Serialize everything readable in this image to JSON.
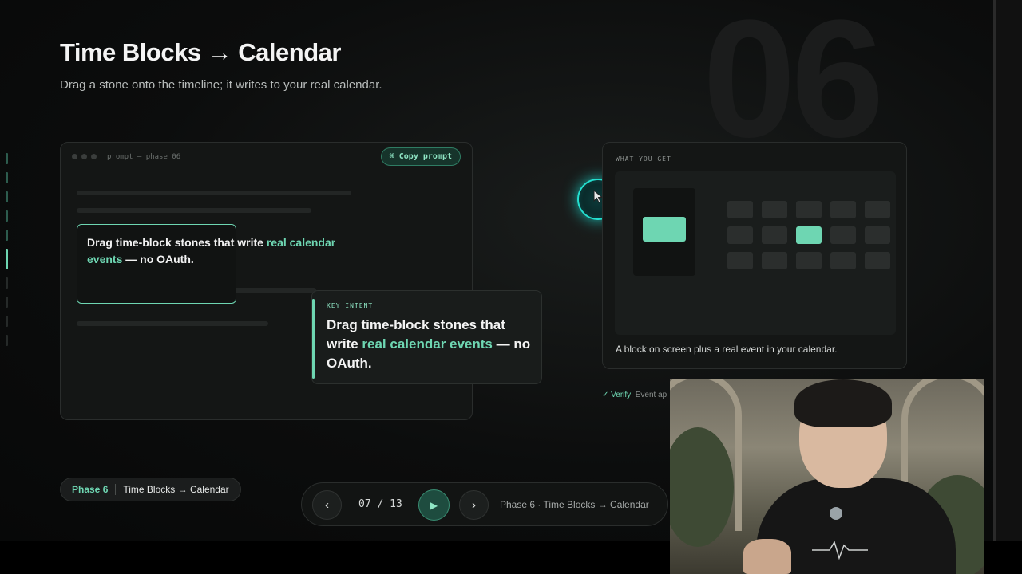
{
  "slide": {
    "title": "Time Blocks → Calendar",
    "subtitle": "Drag a stone onto the timeline; it writes to your real calendar.",
    "background_number": "06"
  },
  "prompt_panel": {
    "label": "prompt — phase 06",
    "copy_button": "⌘ Copy prompt",
    "drag_text_pre": "Drag time-block stones that write ",
    "drag_text_accent": "real calendar events",
    "drag_text_post": " — no OAuth."
  },
  "intent": {
    "label": "KEY INTENT",
    "text_pre": "Drag time-block stones that write ",
    "text_accent": "real calendar events",
    "text_post": " — no OAuth."
  },
  "what_you_get": {
    "label": "WHAT YOU GET",
    "caption": "A block on screen plus a real event in your calendar."
  },
  "verify": {
    "check": "✓ Verify",
    "text": "Event ap"
  },
  "phase_pill": {
    "phase": "Phase 6",
    "name": "Time Blocks → Calendar"
  },
  "player": {
    "prev_icon": "‹",
    "counter": "07 / 13",
    "play_icon": "▶",
    "next_icon": "›",
    "label": "Phase 6 · Time Blocks → Calendar",
    "current": 7,
    "total": 13
  },
  "colors": {
    "accent": "#6ed6b2",
    "cursor_ring": "#24e0d0"
  },
  "icons": [
    "chevron-left-icon",
    "play-icon",
    "chevron-right-icon",
    "cursor-icon",
    "command-icon"
  ]
}
